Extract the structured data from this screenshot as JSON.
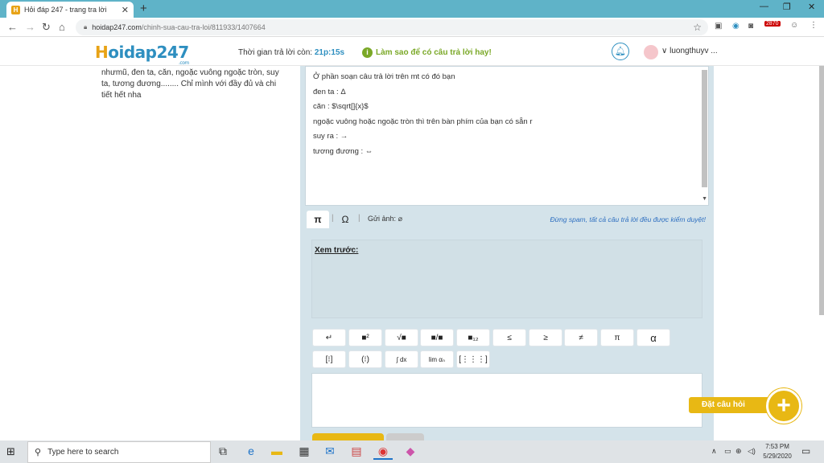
{
  "browser": {
    "tab_title": "Hỏi đáp 247 - trang tra lời",
    "tab_close": "✕",
    "new_tab": "+",
    "url_domain": "hoidap247.com",
    "url_path": "/chinh-sua-cau-tra-loi/811933/1407664",
    "window_min": "—",
    "window_max": "❐",
    "window_close": "✕",
    "ext_badge": "2870"
  },
  "site": {
    "logo_h": "H",
    "logo_rest": "oidap247",
    "logo_com": ".com",
    "timer_label": "Thời gian trả lời còn: ",
    "timer_value": "21p:15s",
    "howto": "Làm sao để có câu trả lời hay!",
    "username": "luongthuyv ..."
  },
  "question": {
    "text": "nhưmũ, đen ta, căn, ngoặc vuông ngoặc tròn, suy ta, tương đương........ Chỉ mình với đầy đủ và chi tiết hết nha"
  },
  "answer": {
    "lines": [
      "Ở phần soạn câu trả lời trên mt có đó bạn",
      "đen ta : Δ",
      "căn : $\\sqrt[]{x}$",
      "ngoặc vuông hoặc ngoặc tròn thì trên bàn phím của bạn có sẵn r",
      "suy ra : →",
      "tương đương : ⇔"
    ]
  },
  "editor": {
    "tab_pi": "π",
    "tab_omega": "Ω",
    "upload_label": "Gửi ảnh:",
    "spam_notice": "Đừng spam, tất cả câu trả lời đều được kiểm duyệt!",
    "preview_label": "Xem trước:",
    "math_row1": [
      "↵",
      "■²",
      "√■",
      "■/■",
      "■₁₂",
      "≤",
      "≥",
      "≠",
      "π",
      "α"
    ],
    "math_row2": [
      "[⁝]",
      "(⁝)",
      "∫ dx",
      "lim αₙ",
      "[⋮⋮⋮]"
    ]
  },
  "fab": {
    "ask_label": "Đặt câu hỏi",
    "plus": "+"
  },
  "taskbar": {
    "search_placeholder": "Type here to search",
    "time": "7:53 PM",
    "date": "5/29/2020"
  }
}
